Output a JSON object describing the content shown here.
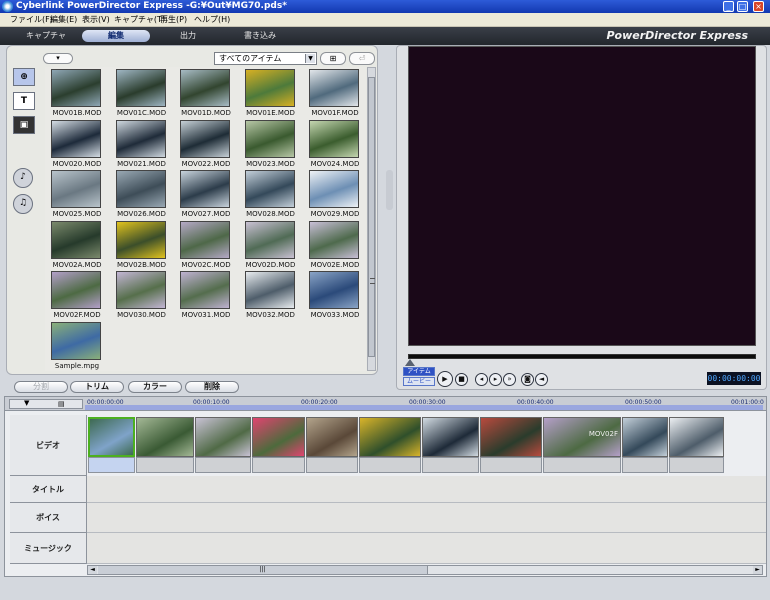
{
  "window": {
    "title": "Cyberlink PowerDirector Express -G:¥Out¥MG70.pds*",
    "minimize": "_",
    "restore": "□",
    "close": "×"
  },
  "menu": [
    "ファイル(F)",
    "編集(E)",
    "表示(V)",
    "キャプチャ(T)",
    "再生(P)",
    "ヘルプ(H)"
  ],
  "mode_tabs": [
    "キャプチャ",
    "編集",
    "出力",
    "書き込み"
  ],
  "active_mode": "編集",
  "brand": "PowerDirector Express",
  "library": {
    "filter": "すべてのアイテム",
    "items": [
      {
        "label": "MOV01B.MOD",
        "c1": "#2b3e2e",
        "c2": "#8fa7b5"
      },
      {
        "label": "MOV01C.MOD",
        "c1": "#2a3c2c",
        "c2": "#9fb6c3"
      },
      {
        "label": "MOV01D.MOD",
        "c1": "#32452f",
        "c2": "#a8bcc5"
      },
      {
        "label": "MOV01E.MOD",
        "c1": "#4d7a3b",
        "c2": "#d7b023"
      },
      {
        "label": "MOV01F.MOD",
        "c1": "#506a7d",
        "c2": "#e2e6ea"
      },
      {
        "label": "MOV020.MOD",
        "c1": "#1d2a3a",
        "c2": "#d5dde4"
      },
      {
        "label": "MOV021.MOD",
        "c1": "#1f2b39",
        "c2": "#cfd8df"
      },
      {
        "label": "MOV022.MOD",
        "c1": "#1e2c36",
        "c2": "#c6d0d6"
      },
      {
        "label": "MOV023.MOD",
        "c1": "#3a5a2f",
        "c2": "#b7c7a6"
      },
      {
        "label": "MOV024.MOD",
        "c1": "#3b5d2e",
        "c2": "#c4d6b0"
      },
      {
        "label": "MOV025.MOD",
        "c1": "#6a7882",
        "c2": "#b9c4cb"
      },
      {
        "label": "MOV026.MOD",
        "c1": "#3e4d58",
        "c2": "#9aa9b4"
      },
      {
        "label": "MOV027.MOD",
        "c1": "#2c3c4a",
        "c2": "#c8d3dc"
      },
      {
        "label": "MOV028.MOD",
        "c1": "#34495a",
        "c2": "#c3cfd9"
      },
      {
        "label": "MOV029.MOD",
        "c1": "#6d8fb4",
        "c2": "#eef2f6"
      },
      {
        "label": "MOV02A.MOD",
        "c1": "#263a2b",
        "c2": "#7b8a6c"
      },
      {
        "label": "MOV02B.MOD",
        "c1": "#3b4e2a",
        "c2": "#e1c31e"
      },
      {
        "label": "MOV02C.MOD",
        "c1": "#4e6848",
        "c2": "#b5a9c6"
      },
      {
        "label": "MOV02D.MOD",
        "c1": "#506b55",
        "c2": "#c9c1d3"
      },
      {
        "label": "MOV02E.MOD",
        "c1": "#4e6a4c",
        "c2": "#c8bfd6"
      },
      {
        "label": "MOV02F.MOD",
        "c1": "#4d6a43",
        "c2": "#b39fc8"
      },
      {
        "label": "MOV030.MOD",
        "c1": "#566f4b",
        "c2": "#c3b6d4"
      },
      {
        "label": "MOV031.MOD",
        "c1": "#546d4d",
        "c2": "#bfb2d1"
      },
      {
        "label": "MOV032.MOD",
        "c1": "#4e5d6a",
        "c2": "#e8ecef"
      },
      {
        "label": "MOV033.MOD",
        "c1": "#2b4a7a",
        "c2": "#8aa4c6"
      },
      {
        "label": "Sample.mpg",
        "c1": "#3e6aa4",
        "c2": "#8ab07a"
      }
    ]
  },
  "preview": {
    "mode_clip": "アイテム",
    "mode_movie": "ムービー",
    "timecode": "00:00:00:00"
  },
  "edit_buttons": {
    "split": "分割",
    "trim": "トリム",
    "color": "カラー",
    "delete": "削除"
  },
  "timeline": {
    "ruler_times": [
      "00:00:00:00",
      "00:00:10:00",
      "00:00:20:00",
      "00:00:30:00",
      "00:00:40:00",
      "00:00:50:00",
      "00:01:00:0"
    ],
    "tracks": [
      "ビデオ",
      "タイトル",
      "ボイス",
      "ミュージック"
    ],
    "clips": [
      {
        "w": 47,
        "c1": "#7fa3c9",
        "c2": "#3e6a52",
        "label": ""
      },
      {
        "w": 58,
        "c1": "#3a5a34",
        "c2": "#a4b896",
        "label": ""
      },
      {
        "w": 56,
        "c1": "#506a46",
        "c2": "#c8c2d4",
        "label": ""
      },
      {
        "w": 53,
        "c1": "#4d6a3c",
        "c2": "#e04470",
        "label": ""
      },
      {
        "w": 52,
        "c1": "#5a4838",
        "c2": "#b3a48c",
        "label": ""
      },
      {
        "w": 62,
        "c1": "#2f4f2b",
        "c2": "#d9b42a",
        "label": ""
      },
      {
        "w": 57,
        "c1": "#1e2a38",
        "c2": "#d2dbe2",
        "label": ""
      },
      {
        "w": 62,
        "c1": "#2a3c2c",
        "c2": "#b84a3e",
        "label": ""
      },
      {
        "w": 78,
        "c1": "#4d6a43",
        "c2": "#b49fc8",
        "label": "MOV02F"
      },
      {
        "w": 46,
        "c1": "#34495a",
        "c2": "#c3cfd9",
        "label": ""
      },
      {
        "w": 55,
        "c1": "#4e5d6a",
        "c2": "#eceff2",
        "label": ""
      }
    ],
    "scroll_grip": "|||",
    "scroll_left": "◄",
    "scroll_right": "►"
  }
}
